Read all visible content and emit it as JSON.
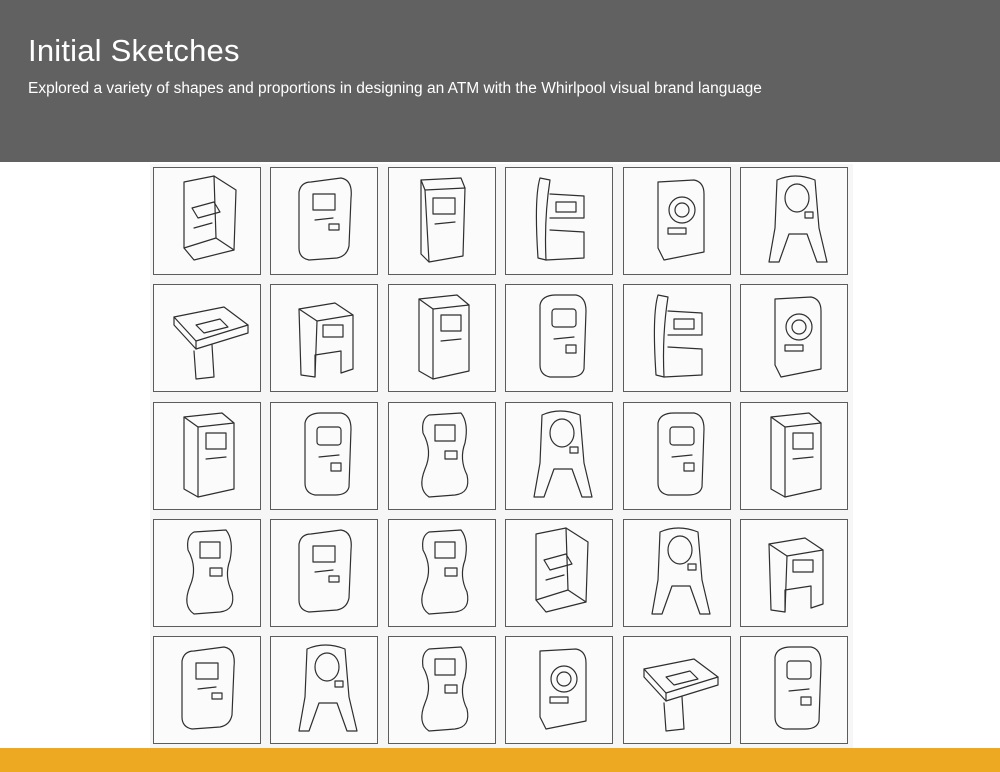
{
  "header": {
    "title": "Initial Sketches",
    "subtitle": "Explored a variety of shapes and proportions in designing an ATM with the Whirlpool visual brand language"
  },
  "colors": {
    "header_bg": "#616161",
    "footer_bar": "#EDA921",
    "sketch_line": "#2f2f2f"
  },
  "sketch_grid": {
    "rows": 5,
    "columns": 6,
    "sketches": [
      {
        "shape": "angled-kiosk"
      },
      {
        "shape": "curved-wall"
      },
      {
        "shape": "tall-pedestal"
      },
      {
        "shape": "side-fin"
      },
      {
        "shape": "round-reader"
      },
      {
        "shape": "arch-legs"
      },
      {
        "shape": "table-top"
      },
      {
        "shape": "block-u"
      },
      {
        "shape": "box-tower"
      },
      {
        "shape": "rounded-tower"
      },
      {
        "shape": "side-fin"
      },
      {
        "shape": "round-reader"
      },
      {
        "shape": "box-tower"
      },
      {
        "shape": "rounded-tower"
      },
      {
        "shape": "s-curve"
      },
      {
        "shape": "arch-legs"
      },
      {
        "shape": "rounded-tower"
      },
      {
        "shape": "box-tower"
      },
      {
        "shape": "s-curve"
      },
      {
        "shape": "curved-wall"
      },
      {
        "shape": "s-curve"
      },
      {
        "shape": "angled-kiosk"
      },
      {
        "shape": "arch-legs"
      },
      {
        "shape": "block-u"
      },
      {
        "shape": "curved-wall"
      },
      {
        "shape": "arch-legs"
      },
      {
        "shape": "s-curve"
      },
      {
        "shape": "round-reader"
      },
      {
        "shape": "table-top"
      },
      {
        "shape": "rounded-tower"
      }
    ]
  }
}
